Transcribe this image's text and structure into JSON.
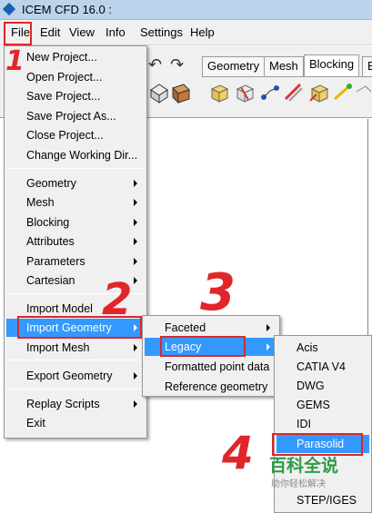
{
  "window": {
    "title": "ICEM CFD 16.0 :"
  },
  "menubar": {
    "items": [
      "File",
      "Edit",
      "View",
      "Info",
      "Settings",
      "Help"
    ]
  },
  "toolbar": {
    "tabs": [
      "Geometry",
      "Mesh",
      "Blocking",
      "E"
    ],
    "active_tab": "Blocking"
  },
  "file_menu": {
    "items": [
      "New Project...",
      "Open Project...",
      "Save Project...",
      "Save Project As...",
      "Close Project...",
      "Change Working Dir...",
      "Geometry",
      "Mesh",
      "Blocking",
      "Attributes",
      "Parameters",
      "Cartesian",
      "Import Model",
      "Import Geometry",
      "Import Mesh",
      "Export Geometry",
      "Replay Scripts",
      "Exit"
    ],
    "highlighted": "Import Geometry"
  },
  "import_geometry_menu": {
    "items": [
      "Faceted",
      "Legacy",
      "Formatted point data",
      "Reference geometry"
    ],
    "highlighted": "Legacy"
  },
  "legacy_menu": {
    "items": [
      "Acis",
      "CATIA V4",
      "DWG",
      "GEMS",
      "IDI",
      "Parasolid",
      "",
      "STEP/IGES"
    ],
    "highlighted": "Parasolid"
  },
  "annotations": {
    "step1": "1",
    "step2": "2",
    "step3": "3",
    "step4": "4"
  },
  "watermark": {
    "title": "百科全说",
    "subtitle": "助你轻松解决"
  },
  "colors": {
    "highlight": "#3399ff",
    "annotation": "#e0262a",
    "titlebar": "#bcd3ec",
    "menu_bg": "#f0f0f0"
  }
}
